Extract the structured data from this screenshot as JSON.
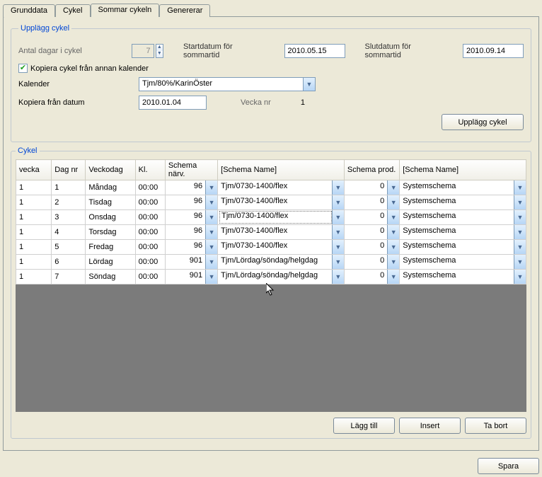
{
  "tabs": [
    "Grunddata",
    "Cykel",
    "Sommar cykeln",
    "Genererar"
  ],
  "group1": {
    "title": "Upplägg  cykel",
    "days_label": "Antal dagar i cykel",
    "days_value": "7",
    "start_label": "Startdatum för sommartid",
    "start_value": "2010.05.15",
    "end_label": "Slutdatum för sommartid",
    "end_value": "2010.09.14",
    "copy_check_label": "Kopiera cykel från annan kalender",
    "calendar_label": "Kalender",
    "calendar_value": "Tjm/80%/KarinÖster",
    "copyfrom_label": "Kopiera från datum",
    "copyfrom_value": "2010.01.04",
    "week_label": "Vecka nr",
    "week_value": "1",
    "btn": "Upplägg  cykel"
  },
  "group2": {
    "title": "Cykel",
    "cols": [
      "vecka",
      "Dag nr",
      "Veckodag",
      "Kl.",
      "Schema närv.",
      "[Schema Name]",
      "Schema prod.",
      "[Schema Name]"
    ],
    "rows": [
      {
        "v": "1",
        "d": "1",
        "w": "Måndag",
        "kl": "00:00",
        "n": "96",
        "s1": "Tjm/0730-1400/flex",
        "p": "0",
        "s2": "Systemschema"
      },
      {
        "v": "1",
        "d": "2",
        "w": "Tisdag",
        "kl": "00:00",
        "n": "96",
        "s1": "Tjm/0730-1400/flex",
        "p": "0",
        "s2": "Systemschema"
      },
      {
        "v": "1",
        "d": "3",
        "w": "Onsdag",
        "kl": "00:00",
        "n": "96",
        "s1": "Tjm/0730-1400/flex",
        "p": "0",
        "s2": "Systemschema"
      },
      {
        "v": "1",
        "d": "4",
        "w": "Torsdag",
        "kl": "00:00",
        "n": "96",
        "s1": "Tjm/0730-1400/flex",
        "p": "0",
        "s2": "Systemschema"
      },
      {
        "v": "1",
        "d": "5",
        "w": "Fredag",
        "kl": "00:00",
        "n": "96",
        "s1": "Tjm/0730-1400/flex",
        "p": "0",
        "s2": "Systemschema"
      },
      {
        "v": "1",
        "d": "6",
        "w": "Lördag",
        "kl": "00:00",
        "n": "901",
        "s1": "Tjm/Lördag/söndag/helgdag",
        "p": "0",
        "s2": "Systemschema"
      },
      {
        "v": "1",
        "d": "7",
        "w": "Söndag",
        "kl": "00:00",
        "n": "901",
        "s1": "Tjm/Lördag/söndag/helgdag",
        "p": "0",
        "s2": "Systemschema"
      }
    ],
    "btn_add": "Lägg till",
    "btn_ins": "Insert",
    "btn_del": "Ta bort"
  },
  "btn_save": "Spara"
}
